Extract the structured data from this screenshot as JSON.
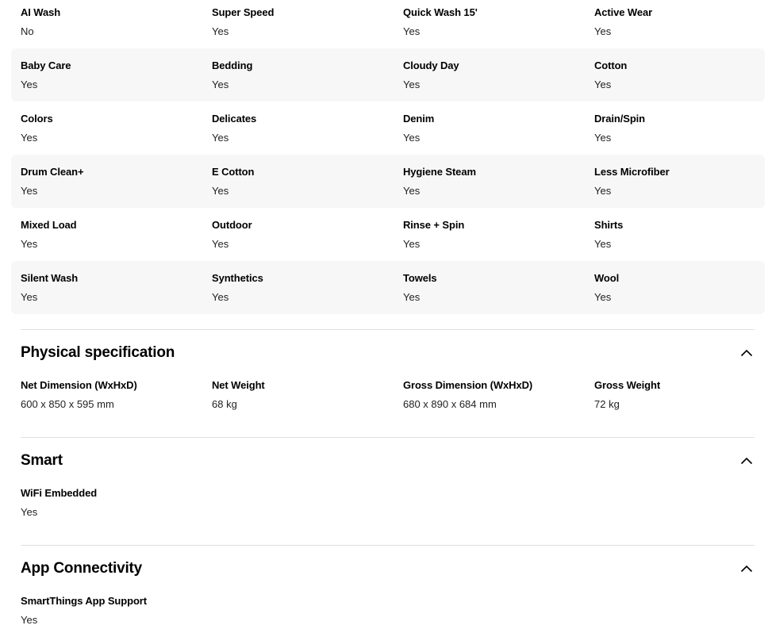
{
  "programs": {
    "rows": [
      [
        {
          "label": "AI Wash",
          "value": "No"
        },
        {
          "label": "Super Speed",
          "value": "Yes"
        },
        {
          "label": "Quick Wash 15'",
          "value": "Yes"
        },
        {
          "label": "Active Wear",
          "value": "Yes"
        }
      ],
      [
        {
          "label": "Baby Care",
          "value": "Yes"
        },
        {
          "label": "Bedding",
          "value": "Yes"
        },
        {
          "label": "Cloudy Day",
          "value": "Yes"
        },
        {
          "label": "Cotton",
          "value": "Yes"
        }
      ],
      [
        {
          "label": "Colors",
          "value": "Yes"
        },
        {
          "label": "Delicates",
          "value": "Yes"
        },
        {
          "label": "Denim",
          "value": "Yes"
        },
        {
          "label": "Drain/Spin",
          "value": "Yes"
        }
      ],
      [
        {
          "label": "Drum Clean+",
          "value": "Yes"
        },
        {
          "label": "E Cotton",
          "value": "Yes"
        },
        {
          "label": "Hygiene Steam",
          "value": "Yes"
        },
        {
          "label": "Less Microfiber",
          "value": "Yes"
        }
      ],
      [
        {
          "label": "Mixed Load",
          "value": "Yes"
        },
        {
          "label": "Outdoor",
          "value": "Yes"
        },
        {
          "label": "Rinse + Spin",
          "value": "Yes"
        },
        {
          "label": "Shirts",
          "value": "Yes"
        }
      ],
      [
        {
          "label": "Silent Wash",
          "value": "Yes"
        },
        {
          "label": "Synthetics",
          "value": "Yes"
        },
        {
          "label": "Towels",
          "value": "Yes"
        },
        {
          "label": "Wool",
          "value": "Yes"
        }
      ]
    ]
  },
  "physical": {
    "title": "Physical specification",
    "items": [
      {
        "label": "Net Dimension (WxHxD)",
        "value": "600 x 850 x 595 mm"
      },
      {
        "label": "Net Weight",
        "value": "68 kg"
      },
      {
        "label": "Gross Dimension (WxHxD)",
        "value": "680 x 890 x 684 mm"
      },
      {
        "label": "Gross Weight",
        "value": "72 kg"
      }
    ]
  },
  "smart": {
    "title": "Smart",
    "items": [
      {
        "label": "WiFi Embedded",
        "value": "Yes"
      }
    ]
  },
  "app": {
    "title": "App Connectivity",
    "items": [
      {
        "label": "SmartThings App Support",
        "value": "Yes"
      }
    ]
  },
  "icons": {
    "collapse": "chevron-up-icon"
  },
  "colors": {
    "shaded_row": "#f7f7f7",
    "divider": "#e0e0e0"
  }
}
